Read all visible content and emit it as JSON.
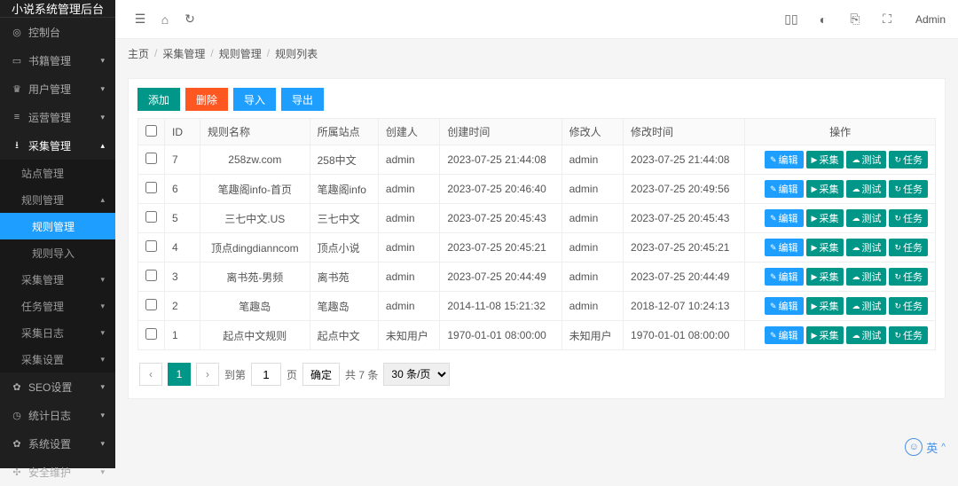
{
  "app_title": "小说系统管理后台",
  "topbar": {
    "user_label": "Admin"
  },
  "breadcrumb": [
    "主页",
    "采集管理",
    "规则管理",
    "规则列表"
  ],
  "sidebar": {
    "items": [
      {
        "label": "控制台",
        "icon": "◎",
        "expandable": false
      },
      {
        "label": "书籍管理",
        "icon": "▭",
        "expandable": true
      },
      {
        "label": "用户管理",
        "icon": "♛",
        "expandable": true
      },
      {
        "label": "运营管理",
        "icon": "≡",
        "expandable": true
      },
      {
        "label": "采集管理",
        "icon": "⭳",
        "expandable": true,
        "expanded": true,
        "children": [
          {
            "label": "站点管理",
            "active": false
          },
          {
            "label": "规则管理",
            "active": false,
            "expandable": true,
            "expanded": true,
            "children": [
              {
                "label": "规则管理",
                "active": true
              },
              {
                "label": "规则导入",
                "active": false
              }
            ]
          },
          {
            "label": "采集管理",
            "active": false,
            "expandable": true
          },
          {
            "label": "任务管理",
            "active": false,
            "expandable": true
          },
          {
            "label": "采集日志",
            "active": false,
            "expandable": true
          },
          {
            "label": "采集设置",
            "active": false,
            "expandable": true
          }
        ]
      },
      {
        "label": "SEO设置",
        "icon": "✿",
        "expandable": true
      },
      {
        "label": "统计日志",
        "icon": "◷",
        "expandable": true
      },
      {
        "label": "系统设置",
        "icon": "✿",
        "expandable": true
      },
      {
        "label": "安全维护",
        "icon": "✣",
        "expandable": true
      }
    ]
  },
  "action_buttons": {
    "add": "添加",
    "delete": "删除",
    "import": "导入",
    "export": "导出"
  },
  "table": {
    "headers": [
      "ID",
      "规则名称",
      "所属站点",
      "创建人",
      "创建时间",
      "修改人",
      "修改时间",
      "操作"
    ],
    "rows": [
      {
        "id": 7,
        "name": "258zw.com",
        "site": "258中文",
        "creator": "admin",
        "created": "2023-07-25 21:44:08",
        "modifier": "admin",
        "modified": "2023-07-25 21:44:08"
      },
      {
        "id": 6,
        "name": "笔趣阁info-首页",
        "site": "笔趣阁info",
        "creator": "admin",
        "created": "2023-07-25 20:46:40",
        "modifier": "admin",
        "modified": "2023-07-25 20:49:56"
      },
      {
        "id": 5,
        "name": "三七中文.US",
        "site": "三七中文",
        "creator": "admin",
        "created": "2023-07-25 20:45:43",
        "modifier": "admin",
        "modified": "2023-07-25 20:45:43"
      },
      {
        "id": 4,
        "name": "顶点dingdianncom",
        "site": "顶点小说",
        "creator": "admin",
        "created": "2023-07-25 20:45:21",
        "modifier": "admin",
        "modified": "2023-07-25 20:45:21"
      },
      {
        "id": 3,
        "name": "离书苑-男频",
        "site": "离书苑",
        "creator": "admin",
        "created": "2023-07-25 20:44:49",
        "modifier": "admin",
        "modified": "2023-07-25 20:44:49"
      },
      {
        "id": 2,
        "name": "笔趣岛",
        "site": "笔趣岛",
        "creator": "admin",
        "created": "2014-11-08 15:21:32",
        "modifier": "admin",
        "modified": "2018-12-07 10:24:13"
      },
      {
        "id": 1,
        "name": "起点中文规则",
        "site": "起点中文",
        "creator": "未知用户",
        "created": "1970-01-01 08:00:00",
        "modifier": "未知用户",
        "modified": "1970-01-01 08:00:00"
      }
    ],
    "row_ops": {
      "edit": "编辑",
      "collect": "采集",
      "test": "测试",
      "task": "任务"
    }
  },
  "pager": {
    "current": 1,
    "goto_label": "到第",
    "page_input": "1",
    "page_label": "页",
    "go": "确定",
    "total": "共 7 条",
    "per_page": "30 条/页"
  },
  "float_label": "英"
}
